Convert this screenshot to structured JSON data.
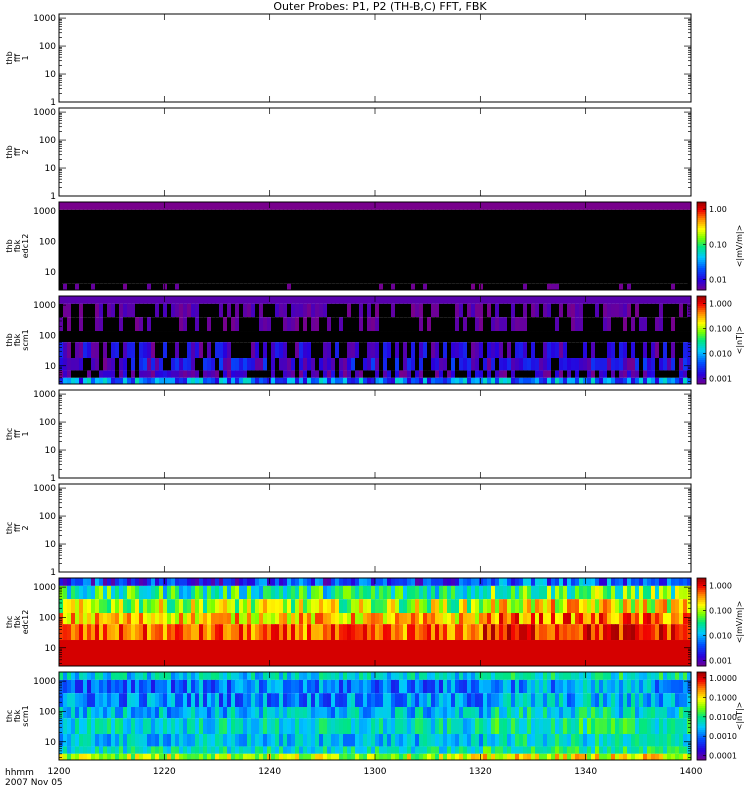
{
  "title": "Outer Probes: P1, P2 (TH-B,C) FFT, FBK",
  "time_axis": {
    "label_line1": "hhmm",
    "label_line2": "2007 Nov 05",
    "ticks": [
      "1200",
      "1220",
      "1240",
      "1300",
      "1320",
      "1340",
      "1400"
    ],
    "range": [
      "1200",
      "1400"
    ]
  },
  "chart_data": [
    {
      "type": "heatmap",
      "panel": "thb-fff-1",
      "ylabel": [
        "thb",
        "fff",
        "1"
      ],
      "scale": "log",
      "yticks": [
        "1",
        "10",
        "100",
        "1000"
      ],
      "ylim": [
        1,
        1400
      ],
      "empty": true
    },
    {
      "type": "heatmap",
      "panel": "thb-fff-2",
      "ylabel": [
        "thb",
        "fff",
        "2"
      ],
      "scale": "log",
      "yticks": [
        "1",
        "10",
        "100",
        "1000"
      ],
      "ylim": [
        1,
        1400
      ],
      "empty": true
    },
    {
      "type": "heatmap",
      "panel": "thb-fbk-edc12",
      "ylabel": [
        "thb",
        "fbk",
        "edc12"
      ],
      "scale": "log",
      "yticks": [
        "10",
        "100",
        "1000"
      ],
      "ylim": [
        2.5,
        2000
      ],
      "bands": [
        {
          "top": 2000,
          "bottom": 1100,
          "level": 0.005,
          "noise": 0
        },
        {
          "top": 1100,
          "bottom": 4,
          "level": 0.0001,
          "noise": 0
        },
        {
          "top": 4,
          "bottom": 2.5,
          "level": 0.003,
          "noise": 0.3
        }
      ],
      "colorbar": {
        "label": "<|mV/m|>",
        "ticks": [
          "1.00",
          "0.10",
          "0.01"
        ],
        "ticks_values": [
          1,
          0.1,
          0.01
        ],
        "range": [
          0.005,
          1.6
        ]
      }
    },
    {
      "type": "heatmap",
      "panel": "thb-fbk-scm1",
      "ylabel": [
        "thb",
        "fbk",
        "scm1"
      ],
      "scale": "log",
      "yticks": [
        "10",
        "100",
        "1000"
      ],
      "ylim": [
        2.5,
        2000
      ],
      "bands": [
        {
          "top": 2000,
          "bottom": 1100,
          "level": 0.0009,
          "noise": 0
        },
        {
          "top": 1100,
          "bottom": 400,
          "level": 0.0006,
          "noise": 0.3
        },
        {
          "top": 400,
          "bottom": 140,
          "level": 0.0005,
          "noise": 0.3
        },
        {
          "top": 140,
          "bottom": 60,
          "level": 0.0001,
          "noise": 0.2
        },
        {
          "top": 60,
          "bottom": 18,
          "level": 0.0009,
          "noise": 0.5
        },
        {
          "top": 18,
          "bottom": 7,
          "level": 0.0012,
          "noise": 0.5
        },
        {
          "top": 7,
          "bottom": 4,
          "level": 0.0008,
          "noise": 0.4
        },
        {
          "top": 4,
          "bottom": 2.5,
          "level": 0.006,
          "noise": 0.6
        }
      ],
      "colorbar": {
        "label": "<|nT|>",
        "ticks": [
          "1.000",
          "0.100",
          "0.010",
          "0.001"
        ],
        "ticks_values": [
          1,
          0.1,
          0.01,
          0.001
        ],
        "range": [
          0.0006,
          2
        ]
      }
    },
    {
      "type": "heatmap",
      "panel": "thc-fff-1",
      "ylabel": [
        "thc",
        "fff",
        "1"
      ],
      "scale": "log",
      "yticks": [
        "1",
        "10",
        "100",
        "1000"
      ],
      "ylim": [
        1,
        1400
      ],
      "empty": true
    },
    {
      "type": "heatmap",
      "panel": "thc-fff-2",
      "ylabel": [
        "thc",
        "fff",
        "2"
      ],
      "scale": "log",
      "yticks": [
        "1",
        "10",
        "100",
        "1000"
      ],
      "ylim": [
        1,
        1400
      ],
      "empty": true
    },
    {
      "type": "heatmap",
      "panel": "thc-fbk-edc12",
      "ylabel": [
        "thc",
        "fbk",
        "edc12"
      ],
      "scale": "log",
      "yticks": [
        "10",
        "100",
        "1000"
      ],
      "ylim": [
        2.5,
        2000
      ],
      "bands": [
        {
          "top": 2000,
          "bottom": 1100,
          "level": 0.003,
          "noise": 0.6
        },
        {
          "top": 1100,
          "bottom": 400,
          "level": 0.03,
          "noise": 0.6
        },
        {
          "top": 400,
          "bottom": 140,
          "level": 0.1,
          "noise": 0.6
        },
        {
          "top": 140,
          "bottom": 60,
          "level": 0.25,
          "noise": 0.5
        },
        {
          "top": 60,
          "bottom": 18,
          "level": 0.5,
          "noise": 0.4
        },
        {
          "top": 18,
          "bottom": 2.5,
          "level": 1.3,
          "noise": 0
        }
      ],
      "colorbar": {
        "label": "<|mV/m|>",
        "ticks": [
          "1.000",
          "0.100",
          "0.010",
          "0.001"
        ],
        "ticks_values": [
          1,
          0.1,
          0.01,
          0.001
        ],
        "range": [
          0.0006,
          2
        ]
      }
    },
    {
      "type": "heatmap",
      "panel": "thc-fbk-scm1",
      "ylabel": [
        "thc",
        "fbk",
        "scm1"
      ],
      "scale": "log",
      "yticks": [
        "10",
        "100",
        "1000"
      ],
      "ylim": [
        2.5,
        2000
      ],
      "bands": [
        {
          "top": 2000,
          "bottom": 1100,
          "level": 0.004,
          "noise": 0.5
        },
        {
          "top": 1100,
          "bottom": 400,
          "level": 0.0012,
          "noise": 0.6
        },
        {
          "top": 400,
          "bottom": 140,
          "level": 0.0015,
          "noise": 0.6
        },
        {
          "top": 140,
          "bottom": 60,
          "level": 0.003,
          "noise": 0.6
        },
        {
          "top": 60,
          "bottom": 18,
          "level": 0.005,
          "noise": 0.5
        },
        {
          "top": 18,
          "bottom": 7,
          "level": 0.003,
          "noise": 0.5
        },
        {
          "top": 7,
          "bottom": 4,
          "level": 0.006,
          "noise": 0.5
        },
        {
          "top": 4,
          "bottom": 2.5,
          "level": 0.05,
          "noise": 0.6
        }
      ],
      "colorbar": {
        "label": "<|nT|>",
        "ticks": [
          "1.0000",
          "0.1000",
          "0.0100",
          "0.0010",
          "0.0001"
        ],
        "ticks_values": [
          1,
          0.1,
          0.01,
          0.001,
          0.0001
        ],
        "range": [
          6e-05,
          2
        ]
      }
    }
  ]
}
